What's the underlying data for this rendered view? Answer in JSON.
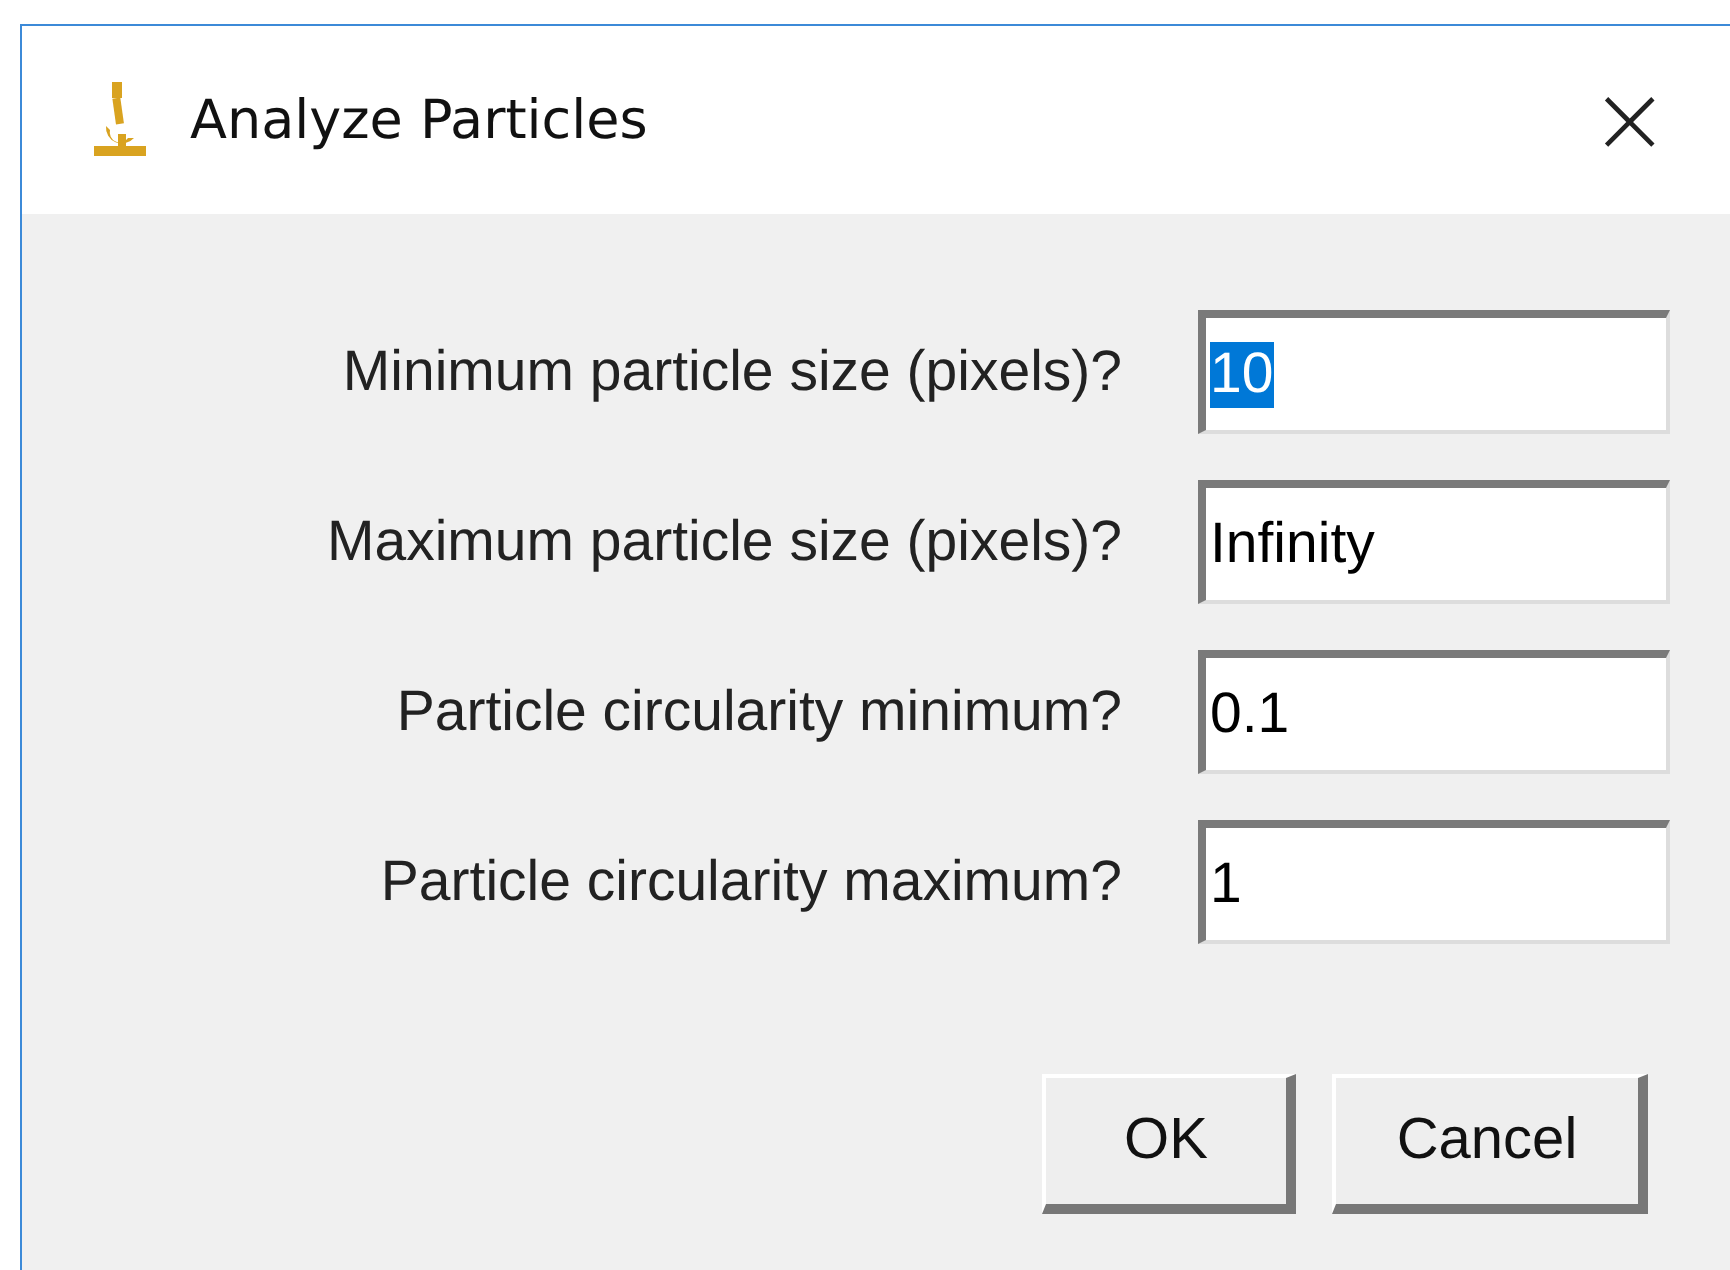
{
  "window": {
    "title": "Analyze Particles",
    "close": "×"
  },
  "fields": [
    {
      "label": "Minimum particle size (pixels)?",
      "value": "10",
      "text_selected": true
    },
    {
      "label": "Maximum particle size (pixels)?",
      "value": "Infinity",
      "text_selected": false
    },
    {
      "label": "Particle circularity minimum?",
      "value": "0.1",
      "text_selected": false
    },
    {
      "label": "Particle circularity maximum?",
      "value": "1",
      "text_selected": false
    }
  ],
  "buttons": [
    "OK",
    "Cancel"
  ]
}
